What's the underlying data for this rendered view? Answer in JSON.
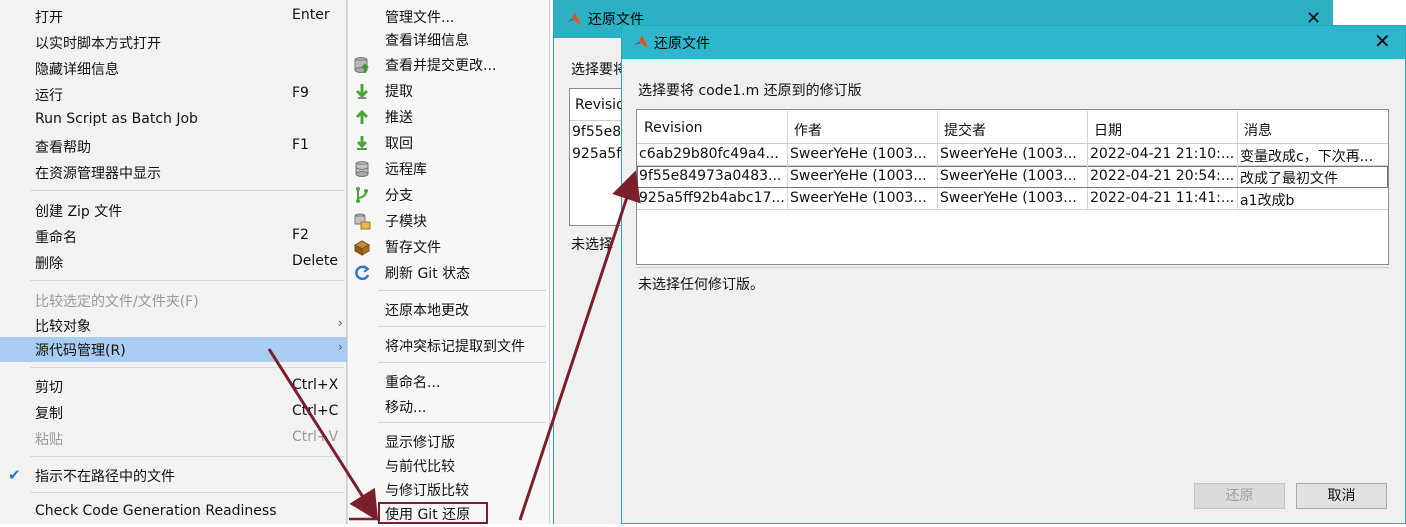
{
  "context_menu": {
    "items": [
      {
        "label": "打开",
        "shortcut": "Enter"
      },
      {
        "label": "以实时脚本方式打开",
        "shortcut": ""
      },
      {
        "label": "隐藏详细信息",
        "shortcut": ""
      },
      {
        "label": "运行",
        "shortcut": "F9"
      },
      {
        "label": "Run Script as Batch Job",
        "shortcut": ""
      },
      {
        "label": "查看帮助",
        "shortcut": "F1"
      },
      {
        "label": "在资源管理器中显示",
        "shortcut": ""
      },
      {
        "label": "创建 Zip 文件",
        "shortcut": ""
      },
      {
        "label": "重命名",
        "shortcut": "F2"
      },
      {
        "label": "删除",
        "shortcut": "Delete"
      },
      {
        "label": "比较选定的文件/文件夹(F)",
        "shortcut": ""
      },
      {
        "label": "比较对象",
        "shortcut": ""
      },
      {
        "label": "源代码管理(R)",
        "shortcut": ""
      },
      {
        "label": "剪切",
        "shortcut": "Ctrl+X"
      },
      {
        "label": "复制",
        "shortcut": "Ctrl+C"
      },
      {
        "label": "粘贴",
        "shortcut": "Ctrl+V"
      },
      {
        "label": "指示不在路径中的文件",
        "shortcut": ""
      },
      {
        "label": "Check Code Generation Readiness",
        "shortcut": ""
      }
    ]
  },
  "submenu": {
    "items": [
      {
        "label": "管理文件...",
        "icon": "none"
      },
      {
        "label": "查看详细信息",
        "icon": "none"
      },
      {
        "label": "查看并提交更改...",
        "icon": "commit-icon"
      },
      {
        "label": "提取",
        "icon": "fetch-icon"
      },
      {
        "label": "推送",
        "icon": "push-icon"
      },
      {
        "label": "取回",
        "icon": "pull-icon"
      },
      {
        "label": "远程库",
        "icon": "remote-icon"
      },
      {
        "label": "分支",
        "icon": "branch-icon"
      },
      {
        "label": "子模块",
        "icon": "submodule-icon"
      },
      {
        "label": "暂存文件",
        "icon": "stash-icon"
      },
      {
        "label": "刷新 Git 状态",
        "icon": "refresh-icon"
      },
      {
        "label": "还原本地更改",
        "icon": "none"
      },
      {
        "label": "将冲突标记提取到文件",
        "icon": "none"
      },
      {
        "label": "重命名...",
        "icon": "none"
      },
      {
        "label": "移动...",
        "icon": "none"
      },
      {
        "label": "显示修订版",
        "icon": "none"
      },
      {
        "label": "与前代比较",
        "icon": "none"
      },
      {
        "label": "与修订版比较",
        "icon": "none"
      },
      {
        "label": "使用 Git 还原",
        "icon": "none"
      }
    ]
  },
  "back_dialog": {
    "title": "还原文件",
    "prompt": "选择要将",
    "column": "Revision",
    "rows": [
      "9f55e8",
      "925a5f"
    ],
    "status": "未选择"
  },
  "dialog": {
    "title": "还原文件",
    "close": "✕",
    "prompt": "选择要将 code1.m 还原到的修订版",
    "columns": [
      "Revision",
      "作者",
      "提交者",
      "日期",
      "消息"
    ],
    "rows": [
      [
        "c6ab29b80fc49a4...",
        "SweerYeHe (1003...",
        "SweerYeHe (1003...",
        "2022-04-21 21:10:...",
        "变量改成c，下次再..."
      ],
      [
        "9f55e84973a0483...",
        "SweerYeHe (1003...",
        "SweerYeHe (1003...",
        "2022-04-21 20:54:...",
        "改成了最初文件"
      ],
      [
        "925a5ff92b4abc17...",
        "SweerYeHe (1003...",
        "SweerYeHe (1003...",
        "2022-04-21 11:41:...",
        "a1改成b"
      ]
    ],
    "status": "未选择任何修订版。",
    "restore_button": "还原",
    "cancel_button": "取消"
  },
  "colors": {
    "titlebar": "#2eb6cc",
    "highlight": "#a9cdf2",
    "annotation": "#7b1f2c"
  }
}
